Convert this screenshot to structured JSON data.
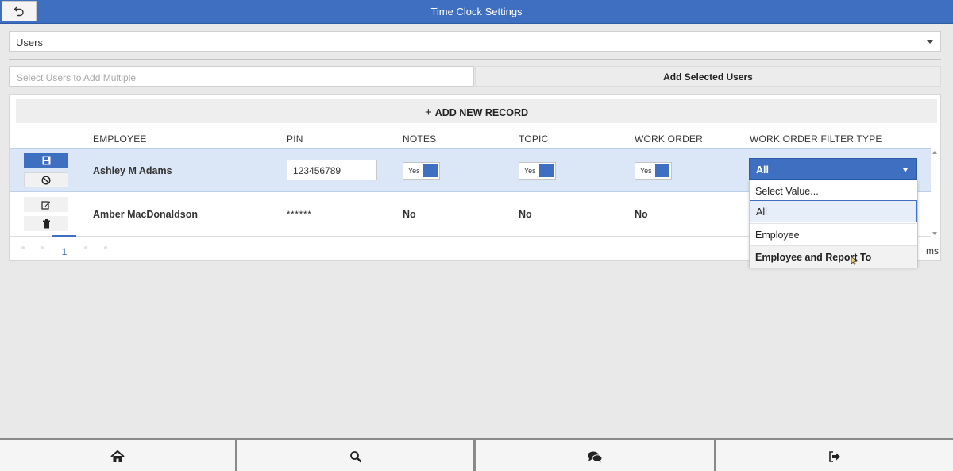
{
  "window": {
    "title": "Time Clock Settings"
  },
  "users_select": {
    "value": "Users"
  },
  "multi_select": {
    "placeholder": "Select Users to Add Multiple",
    "add_button": "Add Selected Users"
  },
  "grid": {
    "toolbar": {
      "plus": "+",
      "add_label": "ADD NEW RECORD"
    },
    "columns": [
      "EMPLOYEE",
      "PIN",
      "NOTES",
      "TOPIC",
      "WORK ORDER",
      "WORK ORDER FILTER TYPE"
    ],
    "rows": [
      {
        "employee": "Ashley M Adams",
        "pin": "123456789",
        "notes": "Yes",
        "topic": "Yes",
        "work_order": "Yes",
        "filter_type": "All"
      },
      {
        "employee": "Amber MacDonaldson",
        "pin": "******",
        "notes": "No",
        "topic": "No",
        "work_order": "No"
      }
    ],
    "pager": {
      "page": "1",
      "items_suffix": "ms"
    }
  },
  "filter_dropdown": {
    "selected": "All",
    "options": [
      "Select Value...",
      "All",
      "Employee",
      "Employee and Report To"
    ]
  },
  "bottom_nav": {
    "icons": [
      "home-icon",
      "search-icon",
      "chat-icon",
      "logout-icon"
    ]
  },
  "colors": {
    "accent": "#3f6fc1",
    "row_selected": "#dbe7f6",
    "background": "#e9e9e9"
  }
}
